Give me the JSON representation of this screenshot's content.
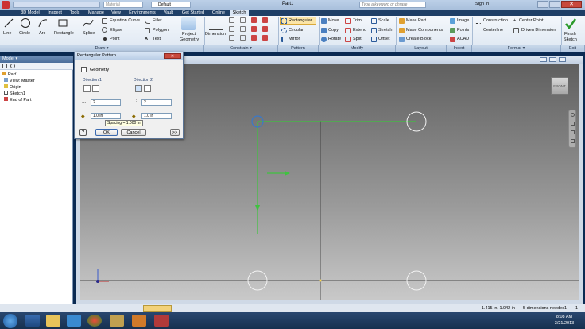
{
  "window": {
    "title": "Part1",
    "search_placeholder": "Type a keyword or phrase",
    "sign_in": "Sign In",
    "material": "Material",
    "appearance": "Default"
  },
  "tabs": [
    "3D Model",
    "Inspect",
    "Tools",
    "Manage",
    "View",
    "Environments",
    "Vault",
    "Get Started",
    "Online",
    "Sketch"
  ],
  "ribbon": {
    "draw": {
      "line": "Line",
      "circle": "Circle",
      "arc": "Arc",
      "rectangle": "Rectangle",
      "spline": "Spline",
      "equation_curve": "Equation Curve",
      "ellipse": "Ellipse",
      "point": "Point",
      "fillet": "Fillet",
      "polygon": "Polygon",
      "text": "Text",
      "project_geometry_1": "Project",
      "project_geometry_2": "Geometry"
    },
    "dimension": "Dimension",
    "pattern": {
      "rectangular": "Rectangular",
      "circular": "Circular",
      "mirror": "Mirror"
    },
    "modify": {
      "move": "Move",
      "trim": "Trim",
      "scale": "Scale",
      "copy": "Copy",
      "extend": "Extend",
      "stretch": "Stretch",
      "rotate": "Rotate",
      "split": "Split",
      "offset": "Offset"
    },
    "layout": {
      "make_part": "Make Part",
      "make_components": "Make Components",
      "create_block": "Create Block"
    },
    "insert": {
      "image": "Image",
      "points": "Points",
      "acad": "ACAD"
    },
    "format": {
      "construction": "Construction",
      "centerline": "Centerline",
      "center_point": "Center Point",
      "driven_dimension": "Driven Dimension"
    },
    "exit": {
      "finish_1": "Finish",
      "finish_2": "Sketch"
    },
    "panels": {
      "draw": "Draw ▾",
      "constrain": "Constrain ▾",
      "pattern": "Pattern",
      "modify": "Modify",
      "layout": "Layout",
      "insert": "Insert",
      "format": "Format ▾",
      "exit": "Exit"
    }
  },
  "browser": {
    "header": "Model ▾",
    "items": [
      "Part1",
      "View: Master",
      "Origin",
      "Sketch1",
      "End of Part"
    ]
  },
  "dialog": {
    "title": "Rectangular Pattern",
    "geometry": "Geometry",
    "direction1": "Direction 1",
    "direction2": "Direction 2",
    "count1": "2",
    "count2": "2",
    "spacing1": "1.0 in",
    "spacing2": "1.0 in",
    "tooltip": "Spacing = 1.000 in",
    "ok": "OK",
    "cancel": "Cancel",
    "more": ">>"
  },
  "viewcube": {
    "label": "FRONT"
  },
  "status": {
    "coords": "-1.415 in, 1.042 in",
    "dims": "5 dimensions needed",
    "page1": "1",
    "page2": "1"
  },
  "taskbar": {
    "time": "8:08 AM",
    "date": "3/21/2013"
  },
  "colors": {
    "accent": "#1f3f66",
    "sketch_line": "#3fc33f"
  }
}
